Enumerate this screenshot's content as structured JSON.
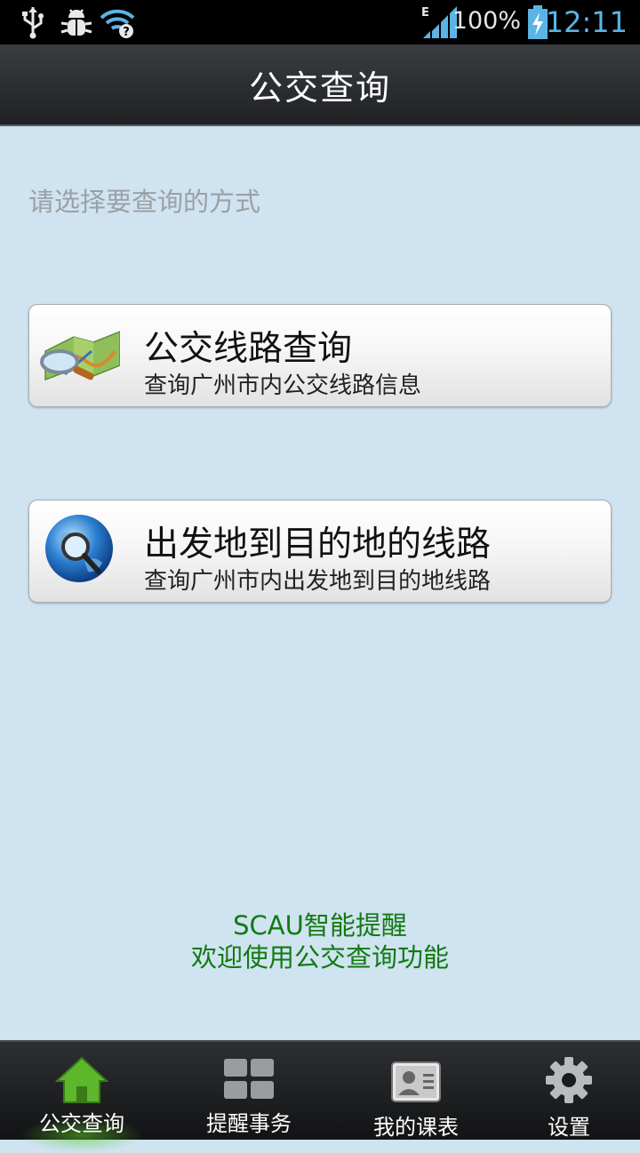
{
  "status_bar": {
    "network_type": "E",
    "battery_percent": "100%",
    "time": "12:11",
    "icons": [
      "usb-icon",
      "debug-bug-icon",
      "wifi-unknown-icon",
      "signal-icon",
      "battery-charging-icon"
    ]
  },
  "header": {
    "title": "公交查询"
  },
  "main": {
    "prompt": "请选择要查询的方式",
    "options": [
      {
        "title": "公交线路查询",
        "subtitle": "查询广州市内公交线路信息",
        "icon": "map-magnifier-icon"
      },
      {
        "title": "出发地到目的地的线路",
        "subtitle": "查询广州市内出发地到目的地线路",
        "icon": "globe-search-icon"
      }
    ]
  },
  "footer": {
    "line1": "SCAU智能提醒",
    "line2": "欢迎使用公交查询功能",
    "color": "#127a12"
  },
  "bottom_nav": {
    "items": [
      {
        "label": "公交查询",
        "icon": "home-icon",
        "active": true
      },
      {
        "label": "提醒事务",
        "icon": "grid-icon",
        "active": false
      },
      {
        "label": "我的课表",
        "icon": "contact-card-icon",
        "active": false
      },
      {
        "label": "设置",
        "icon": "gear-icon",
        "active": false
      }
    ],
    "active_color": "#5cb82a"
  }
}
